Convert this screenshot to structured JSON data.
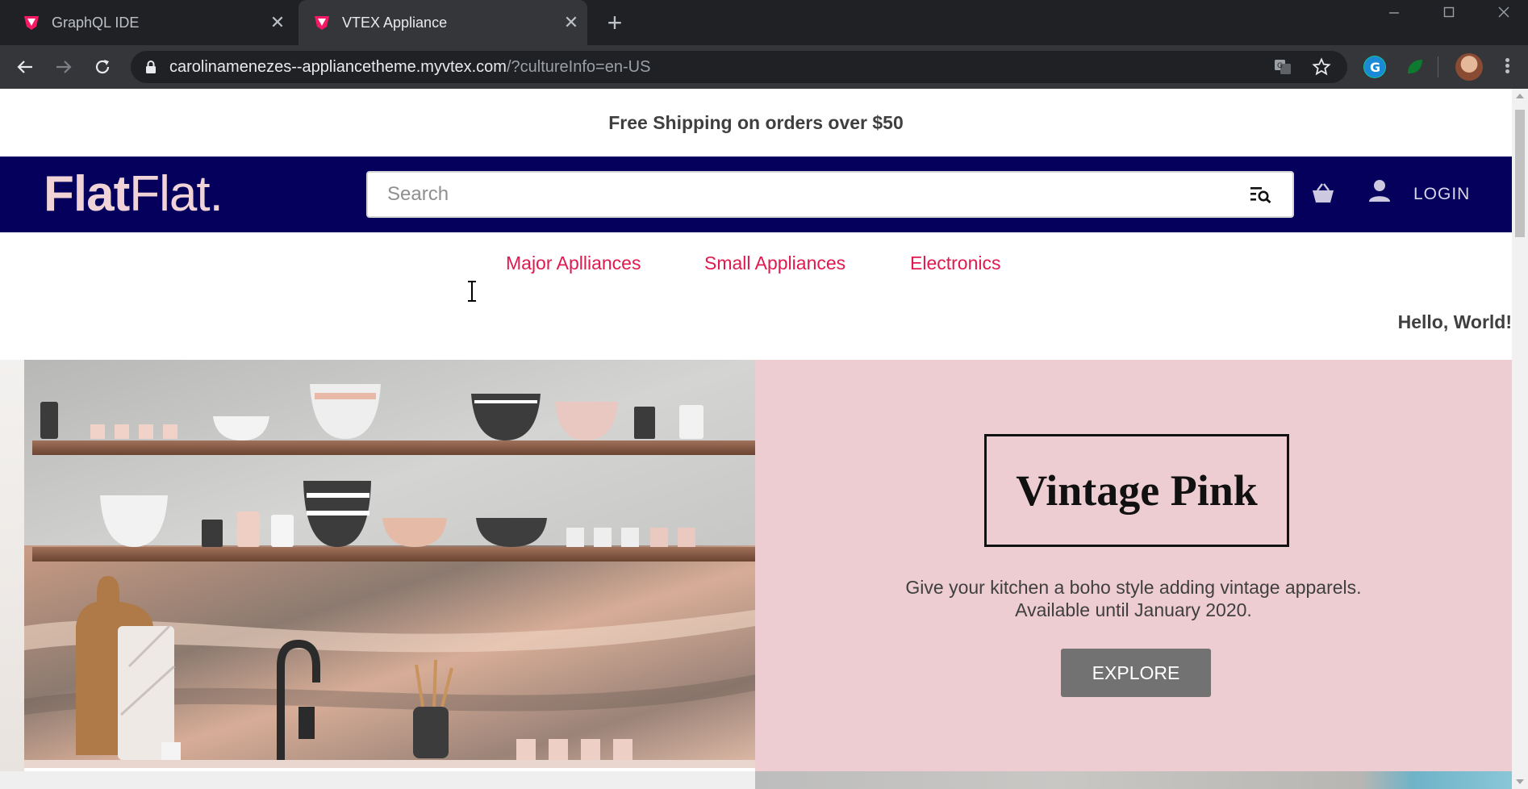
{
  "browser": {
    "tabs": [
      {
        "title": "GraphQL IDE",
        "active": false
      },
      {
        "title": "VTEX Appliance",
        "active": true
      }
    ],
    "url": {
      "host": "carolinamenezes--appliancetheme.myvtex.com",
      "path": "/?cultureInfo=en-US"
    }
  },
  "page": {
    "promo_text": "Free Shipping on orders over $50",
    "logo": {
      "bold": "Flat",
      "light": "Flat."
    },
    "search_placeholder": "Search",
    "login_label": "LOGIN",
    "menu": [
      {
        "label": "Major Aplliances"
      },
      {
        "label": "Small Appliances"
      },
      {
        "label": "Electronics"
      }
    ],
    "hello_text": "Hello, World!",
    "hero": {
      "title": "Vintage Pink",
      "description_line1": "Give your kitchen a boho style adding vintage apparels.",
      "description_line2": "Available until January 2020.",
      "cta_label": "EXPLORE"
    }
  },
  "colors": {
    "header_bg": "#04005c",
    "menu_link": "#e1194e",
    "logo": "#efd3d7",
    "hero_pink": "#edcdd2",
    "cta_bg": "#727272"
  }
}
